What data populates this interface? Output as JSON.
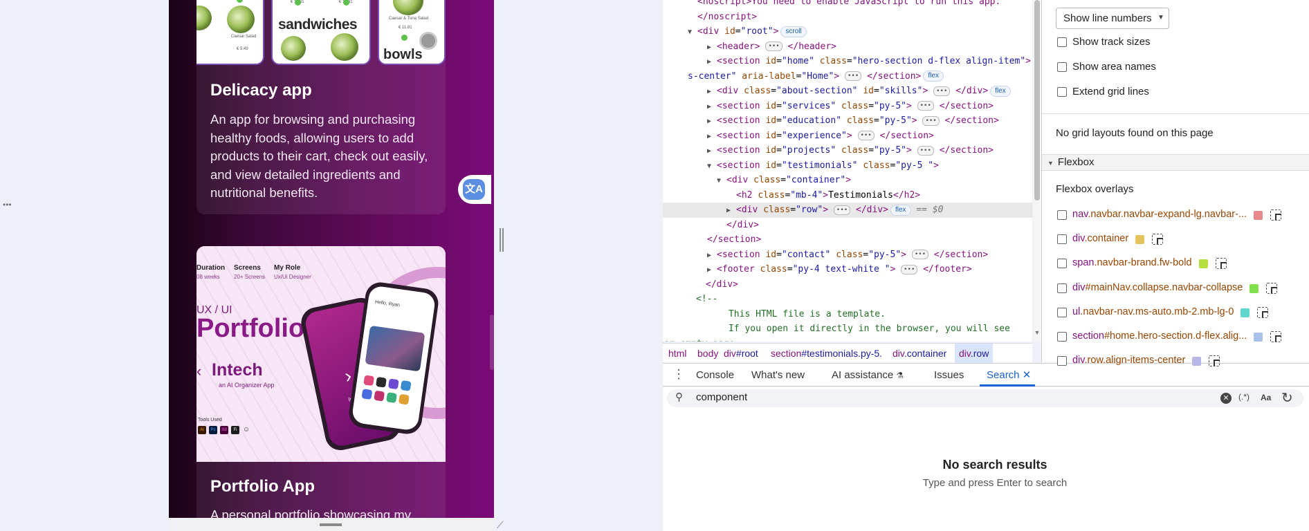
{
  "preview": {
    "card1": {
      "title": "Delicacy app",
      "description": "An app for browsing and purchasing healthy foods, allowing users to add products to their cart, check out easily, and view detailed ingredients and nutritional benefits.",
      "thumbs": {
        "a_price": "€ 5.49",
        "a_label": "Caesar Salad",
        "b_price1": "€ 11.81",
        "b_price2": "€ 11.81",
        "b_title": "sandwiches",
        "c_label": "Caesar & Tuna Salad",
        "c_price": "€ 11.81",
        "c_title": "bowls"
      }
    },
    "card2": {
      "title": "Portfolio App",
      "description": "A personal portfolio showcasing my",
      "image": {
        "h_duration": "Duration",
        "v_duration": "08 weeks",
        "h_screens": "Screens",
        "v_screens": "20+ Screens",
        "h_role": "My Role",
        "v_role": "Ux/Ui Designer",
        "uxui": "UX / UI",
        "portfolio": "Portfolio",
        "intech": "Intech",
        "ai_org": "an AI Organizer App",
        "tools_used": "Tools Used",
        "phone_label": "Intech",
        "phone2_greeting": "Hello, Ryan",
        "tool_icons": [
          "Ai",
          "Ps",
          "Xd",
          "Fi",
          "☺"
        ]
      }
    },
    "translate_icon": "translate-icon"
  },
  "elements": {
    "lines": [
      {
        "type": "raw",
        "html": "&lt;noscript&gt;You need to enable JavaScript to run this app."
      },
      {
        "type": "close",
        "tag": "noscript"
      },
      {
        "type": "open",
        "tag": "div",
        "attrs": [
          [
            "id",
            "root"
          ]
        ],
        "badge": "scroll",
        "expanded": true
      },
      {
        "type": "collapsed",
        "tag": "header",
        "attrs": []
      },
      {
        "type": "collapsed",
        "tag": "section",
        "attrs": [
          [
            "id",
            "home"
          ],
          [
            "class",
            "hero-section d-flex align-item"
          ]
        ]
      },
      {
        "type": "cont",
        "text": "s-center",
        "attrs2": [
          [
            "aria-label",
            "Home"
          ]
        ],
        "badge": "flex"
      },
      {
        "type": "collapsed",
        "tag": "div",
        "attrs": [
          [
            "class",
            "about-section"
          ],
          [
            "id",
            "skills"
          ]
        ],
        "badge": "flex"
      },
      {
        "type": "collapsed",
        "tag": "section",
        "attrs": [
          [
            "id",
            "services"
          ],
          [
            "class",
            "py-5"
          ]
        ]
      },
      {
        "type": "collapsed",
        "tag": "section",
        "attrs": [
          [
            "id",
            "education"
          ],
          [
            "class",
            "py-5"
          ]
        ]
      },
      {
        "type": "collapsed",
        "tag": "section",
        "attrs": [
          [
            "id",
            "experience"
          ]
        ]
      },
      {
        "type": "collapsed",
        "tag": "section",
        "attrs": [
          [
            "id",
            "projects"
          ],
          [
            "class",
            "py-5"
          ]
        ]
      },
      {
        "type": "open",
        "tag": "section",
        "attrs": [
          [
            "id",
            "testimonials"
          ],
          [
            "class",
            "py-5 "
          ]
        ],
        "expanded": true
      },
      {
        "type": "open",
        "tag": "div",
        "attrs": [
          [
            "class",
            "container"
          ]
        ],
        "expanded": true,
        "indent": 1
      },
      {
        "type": "leaf",
        "tag": "h2",
        "attrs": [
          [
            "class",
            "mb-4"
          ]
        ],
        "text": "Testimonials",
        "indent": 2
      },
      {
        "type": "collapsed",
        "tag": "div",
        "attrs": [
          [
            "class",
            "row"
          ]
        ],
        "badge": "flex",
        "selected": true,
        "indent": 2,
        "suffix": "== $0"
      },
      {
        "type": "close",
        "tag": "div",
        "indent": 1
      },
      {
        "type": "close",
        "tag": "section"
      },
      {
        "type": "collapsed",
        "tag": "section",
        "attrs": [
          [
            "id",
            "contact"
          ],
          [
            "class",
            "py-5"
          ]
        ]
      },
      {
        "type": "collapsed",
        "tag": "footer",
        "attrs": [
          [
            "class",
            "py-4  text-white "
          ]
        ]
      },
      {
        "type": "close",
        "tag": "div",
        "indent": -1
      },
      {
        "type": "comment",
        "text": "&lt;!--"
      },
      {
        "type": "comment",
        "text": "      This HTML file is a template."
      },
      {
        "type": "comment",
        "text": "      If you open it directly in the browser, you will see"
      },
      {
        "type": "comment2",
        "text": "an empty page."
      }
    ],
    "breadcrumbs": [
      {
        "tag": "html",
        "cls": ""
      },
      {
        "tag": "body",
        "cls": ""
      },
      {
        "tag": "div",
        "cls": "#root"
      },
      {
        "tag": "section",
        "cls": "#testimonials.py-5."
      },
      {
        "tag": "div",
        "cls": ".container"
      },
      {
        "tag": "div",
        "cls": ".row"
      }
    ]
  },
  "drawer": {
    "menu_icon": "kebab-menu-icon",
    "tabs": [
      "Console",
      "What's new",
      "AI assistance",
      "Issues",
      "Search"
    ],
    "active_tab": "Search",
    "search": {
      "query": "component",
      "regex_label": "(.*)",
      "case_label": "Aa",
      "no_results": "No search results",
      "hint": "Type and press Enter to search"
    }
  },
  "sidebar": {
    "line_select": "Show line numbers",
    "options": [
      "Show track sizes",
      "Show area names",
      "Extend grid lines"
    ],
    "no_grid": "No grid layouts found on this page",
    "flexbox_section": "Flexbox",
    "flexbox_overlays_label": "Flexbox overlays",
    "overlays": [
      {
        "tag": "nav",
        "cls": ".navbar.navbar-expand-lg.navbar-...",
        "color": "#e8888c"
      },
      {
        "tag": "div",
        "cls": ".container",
        "color": "#e6c35a"
      },
      {
        "tag": "span",
        "cls": ".navbar-brand.fw-bold",
        "color": "#b6e040"
      },
      {
        "tag": "div",
        "cls": "#mainNav.collapse.navbar-collapse",
        "color": "#7fe04a"
      },
      {
        "tag": "ul",
        "cls": ".navbar-nav.ms-auto.mb-2.mb-lg-0",
        "color": "#5ed6c9"
      },
      {
        "tag": "section",
        "cls": "#home.hero-section.d-flex.alig...",
        "color": "#a9c2ea"
      },
      {
        "tag": "div",
        "cls": ".row.align-items-center",
        "color": "#b9b6e8"
      }
    ]
  }
}
